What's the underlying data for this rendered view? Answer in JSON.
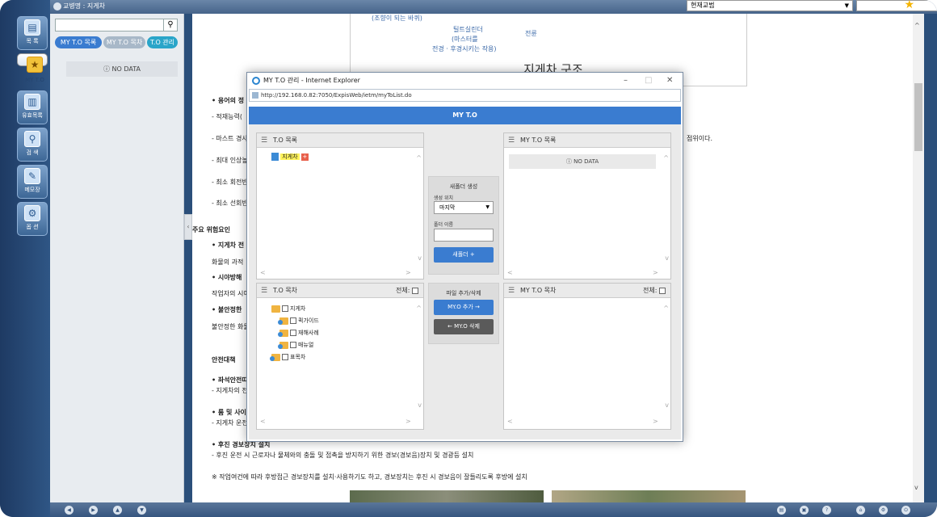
{
  "topbar": {
    "title": "교병명 : 지게차",
    "select_value": "현재교범"
  },
  "rail": {
    "items": [
      {
        "label": "목 록",
        "icon": "book-list-icon"
      },
      {
        "label": "MY T.O",
        "icon": "star-folder-icon"
      },
      {
        "label": "유효목록",
        "icon": "document-list-icon"
      },
      {
        "label": "검 색",
        "icon": "search-icon"
      },
      {
        "label": "메모장",
        "icon": "memo-icon"
      },
      {
        "label": "옵 션",
        "icon": "gear-icon"
      }
    ]
  },
  "panel": {
    "tabs": [
      "MY T.O 목록",
      "MY T.O 목차",
      "T.O 관리"
    ],
    "nodata": "NO DATA"
  },
  "document": {
    "diagram": {
      "label1": "(조향이 되는 바퀴)",
      "label2": "틸트실린더",
      "label3": "(마스터를",
      "label4": "전경 · 후경시키는 작용)",
      "label5": "전륜",
      "title": "지게차 구조"
    },
    "lines": [
      "• 용어의 정",
      "- 적재능력(",
      "- 마스트 경사",
      "- 최대 인상높",
      "- 최소 회전반",
      "- 최소 선회반",
      "주요 위험요인",
      "• 지게차 전",
      "화물의 과적",
      "• 시야방해",
      "작업자의 시야",
      "• 불안정한",
      "불안정한 화물",
      "안전대책",
      "• 좌석안전띠",
      "- 지게차의 전",
      "• 룸 및 사이",
      "- 지게차 운전",
      "• 후진 경보장치 설치",
      "- 후진 운전 시 근로자나 물체와의 충돌 및 접촉을 방지하기 위한 경보(경보음)장치 및 경광등 설치",
      "※ 작업여건에 따라 후방접근 경보장치를 설치·사용하기도 하고, 경보장치는 후진 시 경보음이 잘들리도록 후방에 설치"
    ],
    "side_text": "점위이다."
  },
  "modal": {
    "window_title": "MY T.O 관리 - Internet Explorer",
    "address": "http://192.168.0.82:7050/ExpisWeb/ietm/myToList.do",
    "header": "MY T.O",
    "to_list": {
      "title": "T.O 목록",
      "item": "지게차"
    },
    "my_to_list": {
      "title": "MY T.O 목록",
      "nodata": "NO DATA"
    },
    "to_contents": {
      "title": "T.O 목차",
      "all_label": "전체",
      "items": [
        "지게차",
        "퀵가이드",
        "재해사례",
        "매뉴얼",
        "표목차"
      ]
    },
    "my_to_contents": {
      "title": "MY T.O 목차",
      "all_label": "전체"
    },
    "new_folder": {
      "title": "새폴더 생성",
      "location_label": "생성 위치",
      "location_value": "마지막",
      "name_label": "폴더 이름",
      "button": "새폴더 +"
    },
    "file_actions": {
      "title": "파일 추가/삭제",
      "add_button": "MY.O 추가 →",
      "delete_button": "← MY.O 삭제"
    }
  },
  "colors": {
    "accent": "#3a7cd0",
    "delete_btn": "#5a5a5a",
    "rail": "#2b4f7a"
  }
}
